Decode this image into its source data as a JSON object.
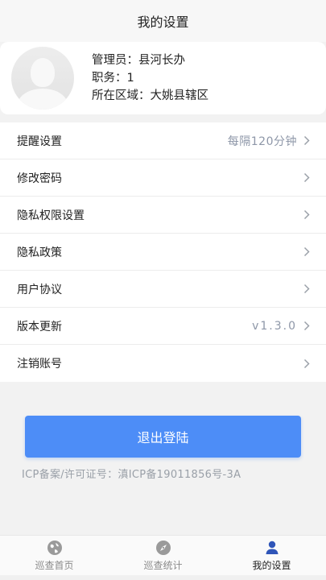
{
  "header": {
    "title": "我的设置"
  },
  "profile": {
    "admin": "管理员：县河长办",
    "position": "职务：1",
    "region": "所在区域：大姚县辖区"
  },
  "menu": [
    {
      "label": "提醒设置",
      "value": "每隔120分钟"
    },
    {
      "label": "修改密码",
      "value": ""
    },
    {
      "label": "隐私权限设置",
      "value": ""
    },
    {
      "label": "隐私政策",
      "value": ""
    },
    {
      "label": "用户协议",
      "value": ""
    },
    {
      "label": "版本更新",
      "value": "v1.3.0"
    },
    {
      "label": "注销账号",
      "value": ""
    }
  ],
  "logout": {
    "label": "退出登陆"
  },
  "icp": "ICP备案/许可证号：滇ICP备19011856号-3A",
  "tabs": [
    {
      "label": "巡查首页",
      "icon": "globe-icon"
    },
    {
      "label": "巡查统计",
      "icon": "compass-icon"
    },
    {
      "label": "我的设置",
      "icon": "user-icon"
    }
  ],
  "colors": {
    "accent": "#4d8df7",
    "muted": "#8e97a8",
    "background": "#f2f2f2"
  }
}
